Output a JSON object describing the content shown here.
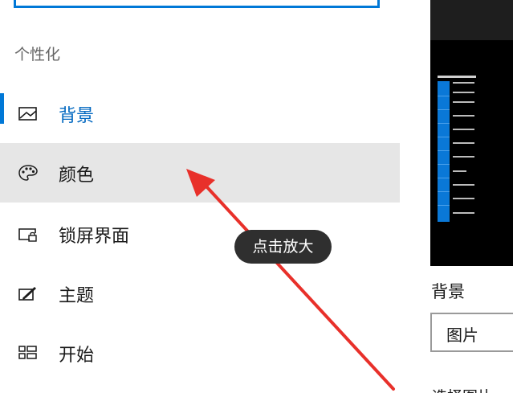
{
  "search": {
    "placeholder": ""
  },
  "sidebar": {
    "section_title": "个性化",
    "items": [
      {
        "label": "背景",
        "icon": "picture-icon",
        "active": true
      },
      {
        "label": "颜色",
        "icon": "palette-icon",
        "hovered": true
      },
      {
        "label": "锁屏界面",
        "icon": "lock-screen-icon"
      },
      {
        "label": "主题",
        "icon": "theme-brush-icon"
      },
      {
        "label": "开始",
        "icon": "start-tiles-icon"
      }
    ]
  },
  "tooltip": {
    "text": "点击放大"
  },
  "main": {
    "background_label": "背景",
    "background_select_value": "图片",
    "cutoff_label": "选择图片"
  },
  "colors": {
    "accent": "#0078d7",
    "active_text": "#0067c0",
    "hover_background": "#e6e6e6",
    "arrow": "#e8302a",
    "tooltip_background": "#2f2f2f",
    "preview_background": "#000000"
  }
}
